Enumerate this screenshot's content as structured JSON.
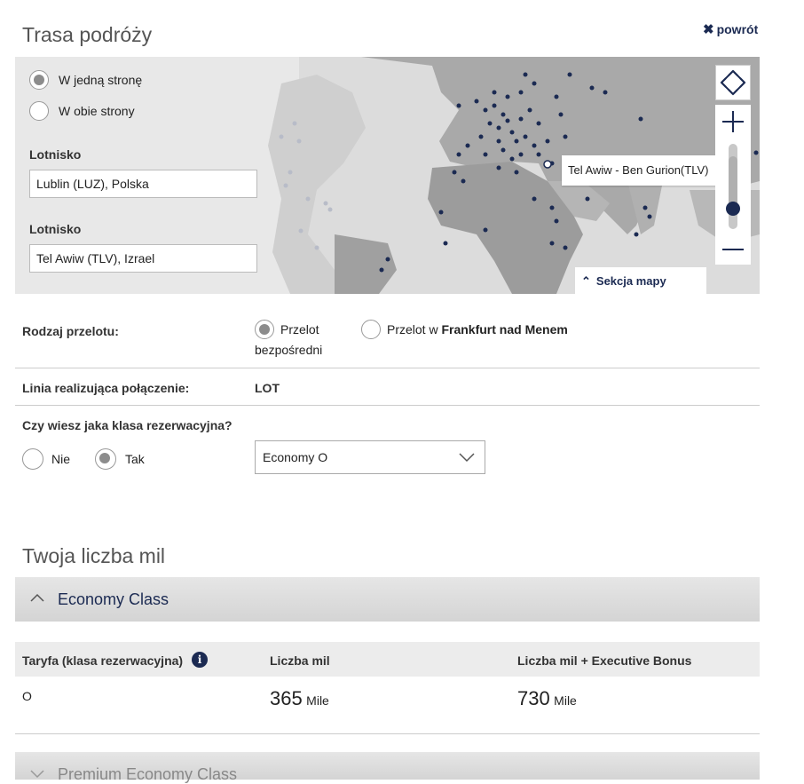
{
  "header": {
    "title": "Trasa podróży",
    "back_label": "powrót"
  },
  "trip_type": {
    "one_way": "W jedną stronę",
    "round_trip": "W obie strony",
    "selected": "one_way"
  },
  "origin": {
    "label": "Lotnisko",
    "value": "Lublin (LUZ), Polska"
  },
  "destination": {
    "label": "Lotnisko",
    "value": "Tel Awiw (TLV), Izrael"
  },
  "map": {
    "tooltip": "Tel Awiw - Ben Gurion(TLV)",
    "section_label": "Sekcja mapy",
    "zoom_level": 0.25
  },
  "flight_type": {
    "label": "Rodzaj przelotu:",
    "direct_line1": "Przelot",
    "direct_line2": "bezpośredni",
    "via_prefix": "Przelot w",
    "via_city": "Frankfurt nad Menem",
    "selected": "direct"
  },
  "carrier": {
    "label": "Linia realizująca połączenie:",
    "value": "LOT"
  },
  "booking_class": {
    "question": "Czy wiesz jaka klasa rezerwacyjna?",
    "no": "Nie",
    "yes": "Tak",
    "selected": "yes",
    "select_value": "Economy O"
  },
  "miles": {
    "title": "Twoja liczba mil",
    "economy": {
      "label": "Economy Class",
      "headers": [
        "Taryfa (klasa rezerwacyjna)",
        "Liczba mil",
        "Liczba mil + Executive Bonus"
      ],
      "rows": [
        {
          "fare": "O",
          "miles": "365",
          "miles_unit": "Mile",
          "bonus": "730",
          "bonus_unit": "Mile"
        }
      ]
    },
    "premium": {
      "label": "Premium Economy Class"
    }
  },
  "colors": {
    "accent": "#1b2a52",
    "radio_fill": "#8c8c8c",
    "map_bg": "#dcdcdc"
  }
}
